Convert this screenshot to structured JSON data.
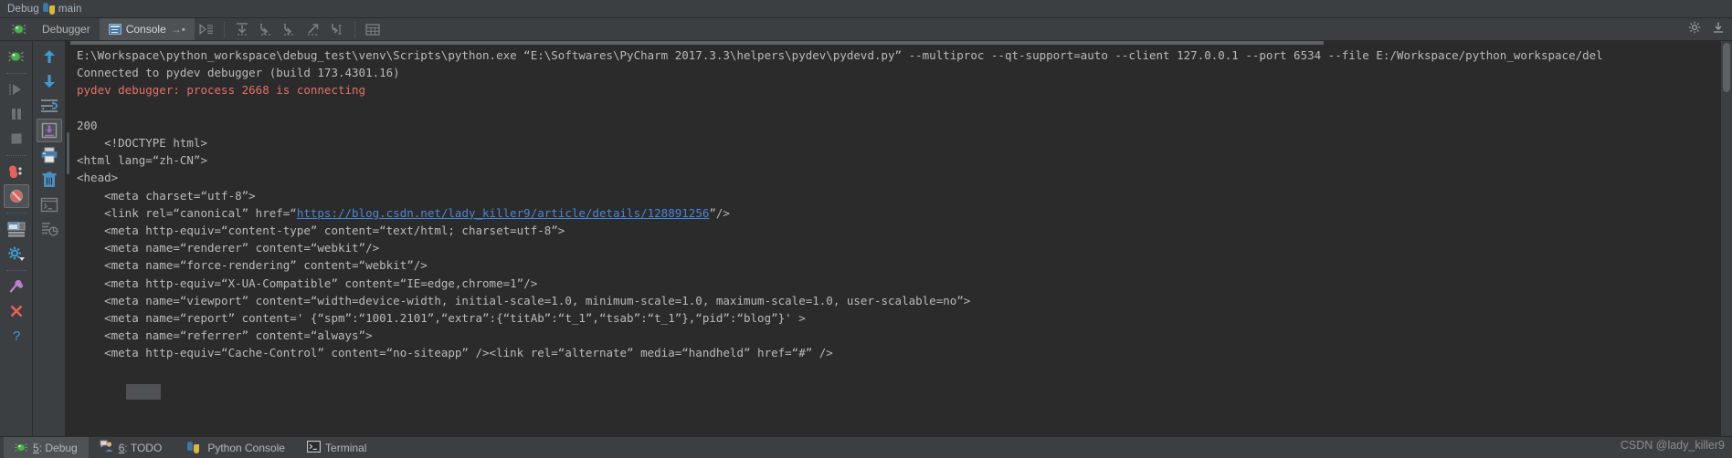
{
  "window": {
    "title_prefix": "Debug",
    "title_config": "main",
    "python_icon": "python-logo-icon"
  },
  "toolbar": {
    "tabs": [
      {
        "label": "Debugger",
        "icon": "bug-icon",
        "active": false
      },
      {
        "label": "Console",
        "icon": "console-window-icon",
        "active": true
      }
    ],
    "soft_wrap_arrow": "→▪",
    "buttons": [
      {
        "name": "rerun-icon",
        "title": "Rerun"
      },
      {
        "name": "step-over-icon",
        "title": "Step Over"
      },
      {
        "name": "step-into-icon",
        "title": "Step Into"
      },
      {
        "name": "force-step-into-icon",
        "title": "Force Step Into"
      },
      {
        "name": "step-out-icon",
        "title": "Step Out"
      },
      {
        "name": "run-to-cursor-icon",
        "title": "Run to Cursor"
      },
      {
        "name": "evaluate-expression-icon",
        "title": "Evaluate Expression"
      }
    ],
    "corner": [
      {
        "name": "settings-gear-icon"
      },
      {
        "name": "hide-panel-icon"
      }
    ]
  },
  "left_gutter": {
    "items": [
      {
        "name": "debug-bug-icon"
      },
      {
        "name": "resume-program-icon"
      },
      {
        "name": "pause-program-icon"
      },
      {
        "name": "mute-breakpoints-icon"
      },
      {
        "name": "stop-icon"
      },
      {
        "name": "view-breakpoints-icon"
      },
      {
        "name": "deny-breakpoints-icon"
      },
      {
        "name": "restore-layout-icon"
      },
      {
        "name": "settings-gear-dropdown-icon"
      },
      {
        "name": "pin-tab-icon"
      },
      {
        "name": "close-icon"
      },
      {
        "name": "help-icon"
      }
    ]
  },
  "second_gutter": {
    "items": [
      {
        "name": "up-arrow-icon"
      },
      {
        "name": "down-arrow-icon"
      },
      {
        "name": "soft-wrap-icon"
      },
      {
        "name": "scroll-to-end-icon"
      },
      {
        "name": "print-icon"
      },
      {
        "name": "clear-all-icon"
      },
      {
        "name": "terminal-icon"
      },
      {
        "name": "export-icon"
      }
    ]
  },
  "console": {
    "lines": [
      {
        "type": "plain",
        "text": "E:\\Workspace\\python_workspace\\debug_test\\venv\\Scripts\\python.exe “E:\\Softwares\\PyCharm 2017.3.3\\helpers\\pydev\\pydevd.py” --multiproc --qt-support=auto --client 127.0.0.1 --port 6534 --file E:/Workspace/python_workspace/del"
      },
      {
        "type": "plain",
        "text": "Connected to pydev debugger (build 173.4301.16)"
      },
      {
        "type": "error",
        "text": "pydev debugger: process 2668 is connecting"
      },
      {
        "type": "plain",
        "text": ""
      },
      {
        "type": "plain",
        "text": "200"
      },
      {
        "type": "plain",
        "text": "    <!DOCTYPE html>"
      },
      {
        "type": "plain",
        "text": "<html lang=“zh-CN”>"
      },
      {
        "type": "plain",
        "text": "<head>"
      },
      {
        "type": "plain",
        "text": "    <meta charset=“utf-8”>"
      },
      {
        "type": "link",
        "pre": "    <link rel=“canonical” href=“",
        "url": "https://blog.csdn.net/lady_killer9/article/details/128891256",
        "post": "”/>"
      },
      {
        "type": "plain",
        "text": "    <meta http-equiv=“content-type” content=“text/html; charset=utf-8”>"
      },
      {
        "type": "plain",
        "text": "    <meta name=“renderer” content=“webkit”/>"
      },
      {
        "type": "plain",
        "text": "    <meta name=“force-rendering” content=“webkit”/>"
      },
      {
        "type": "plain",
        "text": "    <meta http-equiv=“X-UA-Compatible” content=“IE=edge,chrome=1”/>"
      },
      {
        "type": "plain",
        "text": "    <meta name=“viewport” content=“width=device-width, initial-scale=1.0, minimum-scale=1.0, maximum-scale=1.0, user-scalable=no”>"
      },
      {
        "type": "plain",
        "text": "    <meta name=“report” content=' {“spm”:“1001.2101”,“extra”:{“titAb”:“t_1”,“tsab”:“t_1”},“pid”:“blog”}' >"
      },
      {
        "type": "plain",
        "text": "    <meta name=“referrer” content=“always”>"
      },
      {
        "type": "plain",
        "text": "    <meta http-equiv=“Cache-Control” content=“no-siteapp” /><link rel=“alternate” media=“handheld” href=“#” />"
      }
    ]
  },
  "statusbar": {
    "items": [
      {
        "key": "5",
        "label": ": Debug",
        "icon": "bug-icon",
        "active": true
      },
      {
        "key": "6",
        "label": ": TODO",
        "icon": "todo-person-icon",
        "active": false
      },
      {
        "key": "",
        "label": "Python Console",
        "icon": "python-logo-icon",
        "active": false
      },
      {
        "key": "",
        "label": "Terminal",
        "icon": "terminal-prompt-icon",
        "active": false
      }
    ],
    "watermark": "CSDN @lady_killer9"
  },
  "colors": {
    "panel_bg": "#3c3f41",
    "console_bg": "#2b2b2b",
    "text": "#a9b7c6",
    "error": "#e2706a",
    "link": "#4a86d8",
    "selection": "#4e5254"
  }
}
